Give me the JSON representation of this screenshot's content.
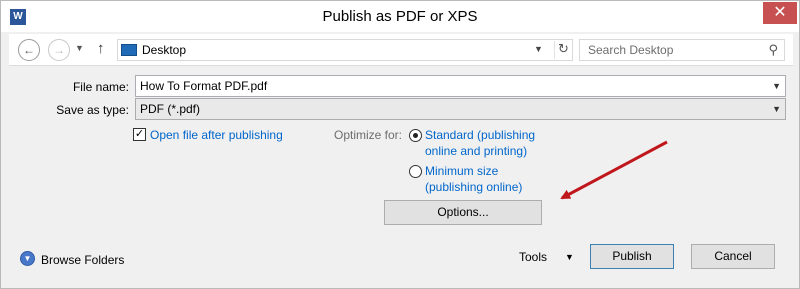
{
  "window": {
    "title": "Publish as PDF or XPS",
    "app_icon_letter": "W",
    "close_glyph": "✕"
  },
  "nav": {
    "back_glyph": "←",
    "forward_glyph": "→",
    "recent_glyph": "▼",
    "up_glyph": "↑",
    "address": "Desktop",
    "refresh_glyph": "↻",
    "search_placeholder": "Search Desktop",
    "search_glyph": "⚲"
  },
  "form": {
    "file_name_label": "File name:",
    "file_name_value": "How To Format PDF.pdf",
    "save_type_label": "Save as type:",
    "save_type_value": "PDF (*.pdf)",
    "open_after_publishing": "Open file after publishing",
    "open_after_checked": true,
    "optimize_label": "Optimize for:",
    "standard_line1": "Standard (publishing",
    "standard_line2": "online and printing)",
    "minimum_line1": "Minimum size",
    "minimum_line2": "(publishing online)",
    "options_button": "Options..."
  },
  "footer": {
    "browse_folders": "Browse Folders",
    "tools": "Tools",
    "publish": "Publish",
    "cancel": "Cancel"
  },
  "colors": {
    "link": "#0066cc",
    "annotation_arrow": "#c0171d",
    "close_button": "#c75050"
  }
}
